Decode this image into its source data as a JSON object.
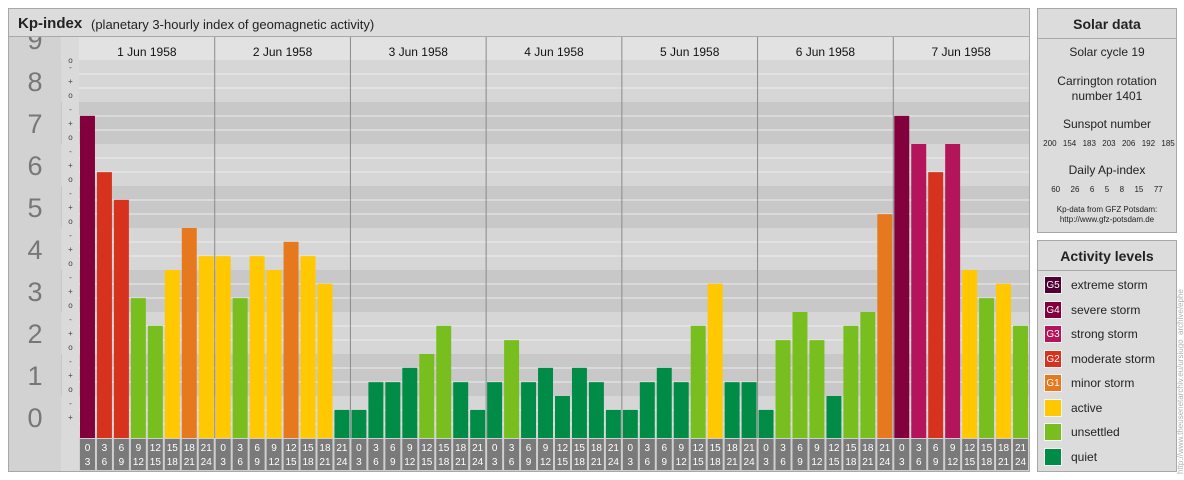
{
  "header": {
    "title": "Kp-index",
    "subtitle": "(planetary 3-hourly index of geomagnetic activity)"
  },
  "chart_data": {
    "type": "bar",
    "title": "Kp-index",
    "ylim": [
      0,
      9
    ],
    "y_ticks": [
      "0",
      "1",
      "2",
      "3",
      "4",
      "5",
      "6",
      "7",
      "8",
      "9"
    ],
    "y_minor_marks": [
      "+",
      "o",
      "-"
    ],
    "days": [
      "1 Jun 1958",
      "2 Jun 1958",
      "3 Jun 1958",
      "4 Jun 1958",
      "5 Jun 1958",
      "6 Jun 1958",
      "7 Jun 1958"
    ],
    "interval_labels": [
      [
        "0",
        "3"
      ],
      [
        "3",
        "6"
      ],
      [
        "6",
        "9"
      ],
      [
        "9",
        "12"
      ],
      [
        "12",
        "15"
      ],
      [
        "15",
        "18"
      ],
      [
        "18",
        "21"
      ],
      [
        "21",
        "24"
      ]
    ],
    "values": [
      [
        7.67,
        6.33,
        5.67,
        3.33,
        2.67,
        4.0,
        5.0,
        4.33
      ],
      [
        4.33,
        3.33,
        4.33,
        4.0,
        4.67,
        4.33,
        3.67,
        0.67
      ],
      [
        0.67,
        1.33,
        1.33,
        1.67,
        2.0,
        2.67,
        1.33,
        0.67
      ],
      [
        1.33,
        2.33,
        1.33,
        1.67,
        1.0,
        1.67,
        1.33,
        0.67
      ],
      [
        0.67,
        1.33,
        1.67,
        1.33,
        2.67,
        3.67,
        1.33,
        1.33
      ],
      [
        0.67,
        2.33,
        3.0,
        2.33,
        1.0,
        2.67,
        3.0,
        5.33
      ],
      [
        7.67,
        7.0,
        6.33,
        7.0,
        4.0,
        3.33,
        3.67,
        2.67
      ]
    ],
    "colors": {
      "quiet": "#008c46",
      "unsettled": "#78be1e",
      "active": "#ffc800",
      "G1": "#e6781e",
      "G2": "#d7321e",
      "G3": "#b4145a",
      "G4": "#82003c",
      "G5": "#500032"
    }
  },
  "solar": {
    "title": "Solar data",
    "cycle": "Solar cycle 19",
    "carrington_line1": "Carrington rotation",
    "carrington_line2": "number 1401",
    "sunspot_label": "Sunspot number",
    "sunspot_values": [
      "200",
      "154",
      "183",
      "203",
      "206",
      "192",
      "185"
    ],
    "ap_label": "Daily Ap-index",
    "ap_values": [
      "60",
      "26",
      "6",
      "5",
      "8",
      "15",
      "77"
    ],
    "credit_line1": "Kp-data from GFZ Potsdam:",
    "credit_line2": "http://www.gfz-potsdam.de"
  },
  "levels": {
    "title": "Activity levels",
    "items": [
      {
        "code": "G5",
        "label": "extreme storm",
        "color": "#500032"
      },
      {
        "code": "G4",
        "label": "severe storm",
        "color": "#82003c"
      },
      {
        "code": "G3",
        "label": "strong storm",
        "color": "#b4145a"
      },
      {
        "code": "G2",
        "label": "moderate storm",
        "color": "#d7321e"
      },
      {
        "code": "G1",
        "label": "minor storm",
        "color": "#e6781e"
      },
      {
        "code": "",
        "label": "active",
        "color": "#ffc800"
      },
      {
        "code": "",
        "label": "unsettled",
        "color": "#78be1e"
      },
      {
        "code": "",
        "label": "quiet",
        "color": "#008c46"
      }
    ]
  },
  "watermark": "http://www.theusenetarchiv.eu/ursiugo_archive/ephe"
}
